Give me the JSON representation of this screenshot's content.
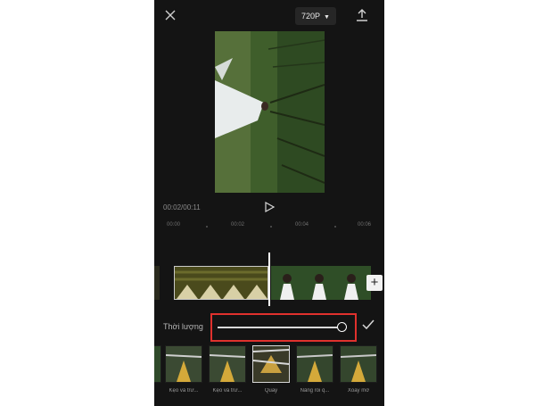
{
  "header": {
    "resolution": "720P",
    "icons": [
      "close-icon",
      "chevron-down-icon",
      "export-icon"
    ]
  },
  "player": {
    "timecode": "00:02/00:11",
    "play_icon": "play-icon"
  },
  "ruler": {
    "ticks": [
      "00:00",
      "00:02",
      "00:04",
      "00:06"
    ]
  },
  "adjust": {
    "duration_label": "Thời lượng",
    "duration_value": 1.0,
    "confirm_icon": "check-icon"
  },
  "effects": {
    "items": [
      {
        "label": "Kẹo và trư..."
      },
      {
        "label": "Kẹo và trư..."
      },
      {
        "label": "Quay"
      },
      {
        "label": "Nâng rồi q..."
      },
      {
        "label": "Xoay mờ"
      }
    ],
    "selected_index": 2
  },
  "colors": {
    "background": "#141414",
    "highlight_border": "#e0312d"
  }
}
